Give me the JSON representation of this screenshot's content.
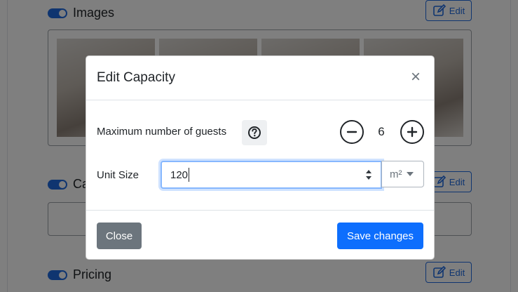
{
  "background": {
    "sections": [
      {
        "title": "Images",
        "edit_label": "Edit"
      },
      {
        "title": "Ca",
        "edit_label": "Edit"
      },
      {
        "title": "Pricing",
        "edit_label": "Edit"
      }
    ]
  },
  "modal": {
    "title": "Edit Capacity",
    "close_symbol": "×",
    "guests": {
      "label": "Maximum number of guests",
      "help_icon": "question-circle-icon",
      "count": "6",
      "decrement_icon": "minus-circle-icon",
      "increment_icon": "plus-circle-icon"
    },
    "unit_size": {
      "label": "Unit Size",
      "value": "120",
      "unit": "m²"
    },
    "footer": {
      "close_label": "Close",
      "save_label": "Save changes"
    }
  },
  "colors": {
    "primary": "#0d6efd",
    "secondary": "#6c757d",
    "toggle": "#1f6ae0"
  }
}
